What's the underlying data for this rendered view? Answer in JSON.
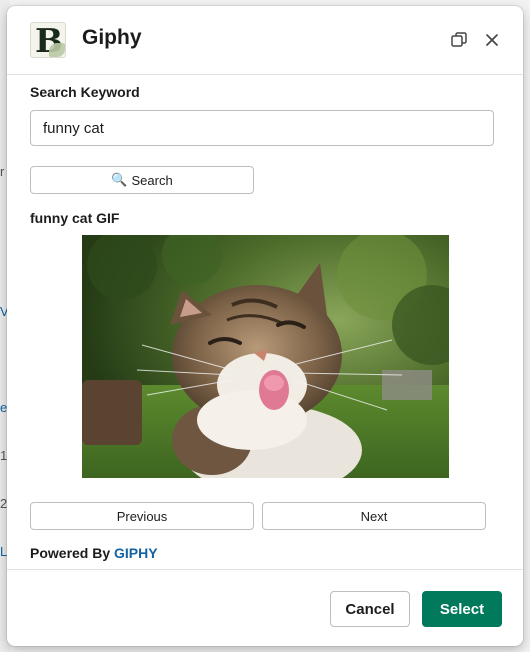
{
  "background": {
    "left_fragments": [
      {
        "text": "r",
        "link": false
      },
      {
        "text": "V",
        "link": true
      },
      {
        "text": "e",
        "link": true
      },
      {
        "text": "1",
        "link": false
      },
      {
        "text": "2",
        "link": false
      },
      {
        "text": "L",
        "link": true
      }
    ]
  },
  "modal": {
    "title": "Giphy",
    "logo_letter": "B",
    "header_icons": [
      "expand-icon",
      "close-icon"
    ]
  },
  "search": {
    "label": "Search Keyword",
    "value": "funny cat",
    "button_icon": "🔍",
    "button_label": "Search"
  },
  "result": {
    "title": "funny cat GIF",
    "image_description": "cat-photo"
  },
  "pagination": {
    "previous_label": "Previous",
    "next_label": "Next"
  },
  "attribution": {
    "prefix": "Powered By ",
    "brand": "GIPHY"
  },
  "footer": {
    "cancel_label": "Cancel",
    "select_label": "Select"
  },
  "colors": {
    "primary_button": "#007a5a",
    "link": "#1264a3"
  }
}
